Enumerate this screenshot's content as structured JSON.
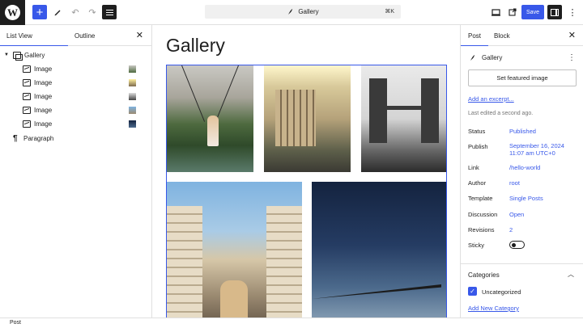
{
  "toolbar": {
    "document_title": "Gallery",
    "shortcut": "⌘K",
    "save_label": "Save",
    "more_icon": "⋮"
  },
  "list_view": {
    "tab_list": "List View",
    "tab_outline": "Outline",
    "items": [
      {
        "label": "Gallery",
        "icon": "gallery-icon"
      },
      {
        "label": "Image",
        "icon": "image-icon"
      },
      {
        "label": "Image",
        "icon": "image-icon"
      },
      {
        "label": "Image",
        "icon": "image-icon"
      },
      {
        "label": "Image",
        "icon": "image-icon"
      },
      {
        "label": "Image",
        "icon": "image-icon"
      },
      {
        "label": "Paragraph",
        "icon": "paragraph-icon"
      }
    ]
  },
  "canvas": {
    "post_title": "Gallery"
  },
  "sidebar": {
    "tab_post": "Post",
    "tab_block": "Block",
    "doc_title": "Gallery",
    "featured_image_button": "Set featured image",
    "excerpt_link": "Add an excerpt...",
    "last_edited": "Last edited a second ago.",
    "meta": {
      "status_label": "Status",
      "status_value": "Published",
      "publish_label": "Publish",
      "publish_value_line1": "September 16, 2024",
      "publish_value_line2": "11:07 am UTC+0",
      "link_label": "Link",
      "link_value": "/hello-world",
      "author_label": "Author",
      "author_value": "root",
      "template_label": "Template",
      "template_value": "Single Posts",
      "discussion_label": "Discussion",
      "discussion_value": "Open",
      "revisions_label": "Revisions",
      "revisions_value": "2",
      "sticky_label": "Sticky"
    },
    "categories": {
      "title": "Categories",
      "items": [
        {
          "label": "Uncategorized",
          "checked": true
        }
      ],
      "add_link": "Add New Category"
    }
  },
  "status_bar": {
    "breadcrumb": "Post"
  },
  "colors": {
    "accent": "#3858e9",
    "dark": "#1e1e1e",
    "border": "#e0e0e0"
  }
}
